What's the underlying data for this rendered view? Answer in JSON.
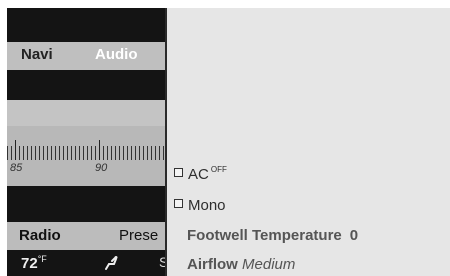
{
  "nav": {
    "navi": "Navi",
    "audio": "Audio"
  },
  "tuner": {
    "labels": [
      "85",
      "90"
    ]
  },
  "softkeys": {
    "radio": "Radio",
    "presets": "Prese"
  },
  "climate": {
    "temp": "72",
    "unit": "°F",
    "partial": "S"
  },
  "menu": {
    "ac": {
      "label": "AC",
      "state": "OFF"
    },
    "mono": {
      "label": "Mono"
    },
    "footwell": {
      "label": "Footwell Temperature",
      "value": "0"
    },
    "airflow": {
      "label": "Airflow",
      "value": "Medium"
    }
  },
  "icons": {
    "seat": "seat-heating-icon",
    "checkbox": "checkbox-icon"
  },
  "colors": {
    "dark": "#141414",
    "panel": "#e6e6e6",
    "bar": "#bfbfbf",
    "text": "#2e2e2e"
  }
}
